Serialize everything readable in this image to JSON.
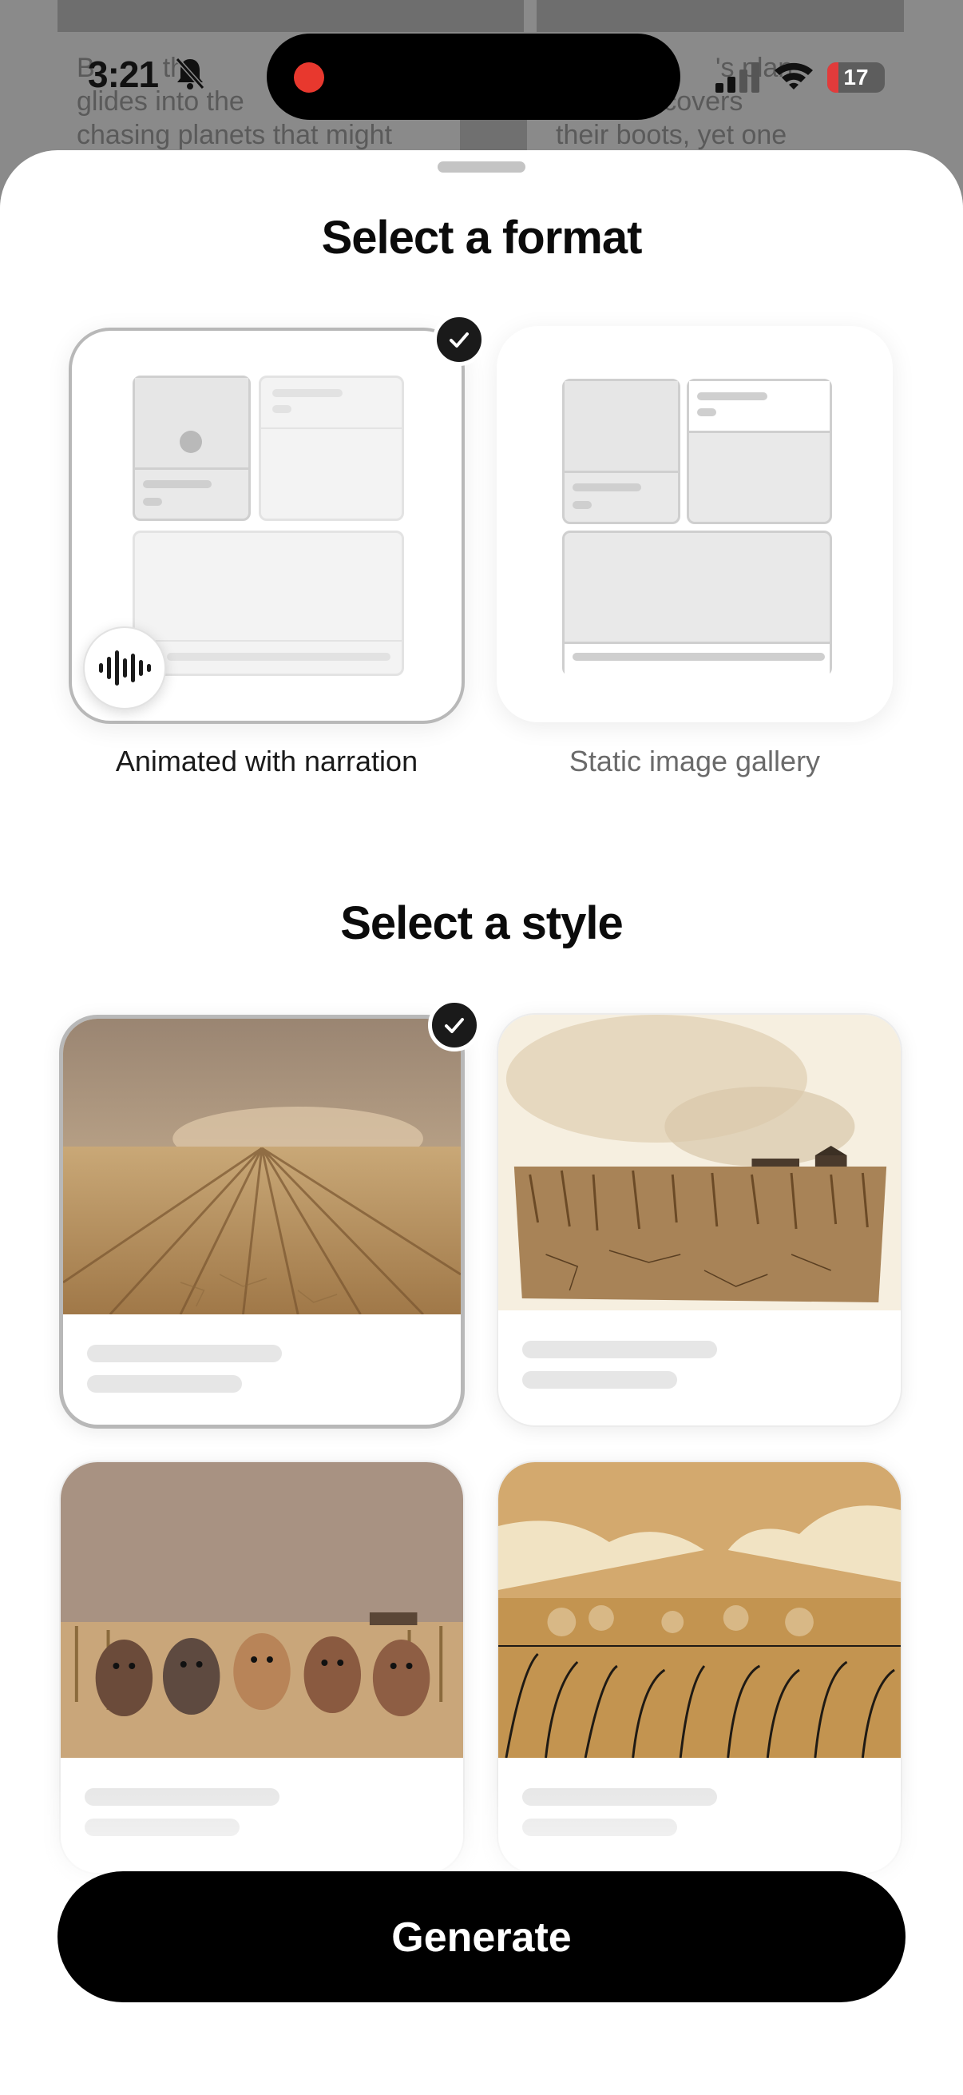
{
  "background": {
    "left_text": [
      "B",
      "glides into the",
      "chasing planets that might"
    ],
    "left_text_partial": "the",
    "right_text": [
      "'s plan",
      "rely covers",
      "their boots, yet one"
    ]
  },
  "status_bar": {
    "time": "3:21",
    "battery": "17"
  },
  "sheet": {
    "format_title": "Select a format",
    "formats": [
      {
        "label": "Animated with narration",
        "selected": true
      },
      {
        "label": "Static image gallery",
        "selected": false
      }
    ],
    "style_title": "Select a style",
    "styles": [
      {
        "selected": true
      },
      {
        "selected": false
      },
      {
        "selected": false
      },
      {
        "selected": false
      }
    ],
    "generate_label": "Generate"
  },
  "colors": {
    "accent": "#000000",
    "recording_dot": "#e8382e",
    "battery_low": "#e23b3b"
  }
}
